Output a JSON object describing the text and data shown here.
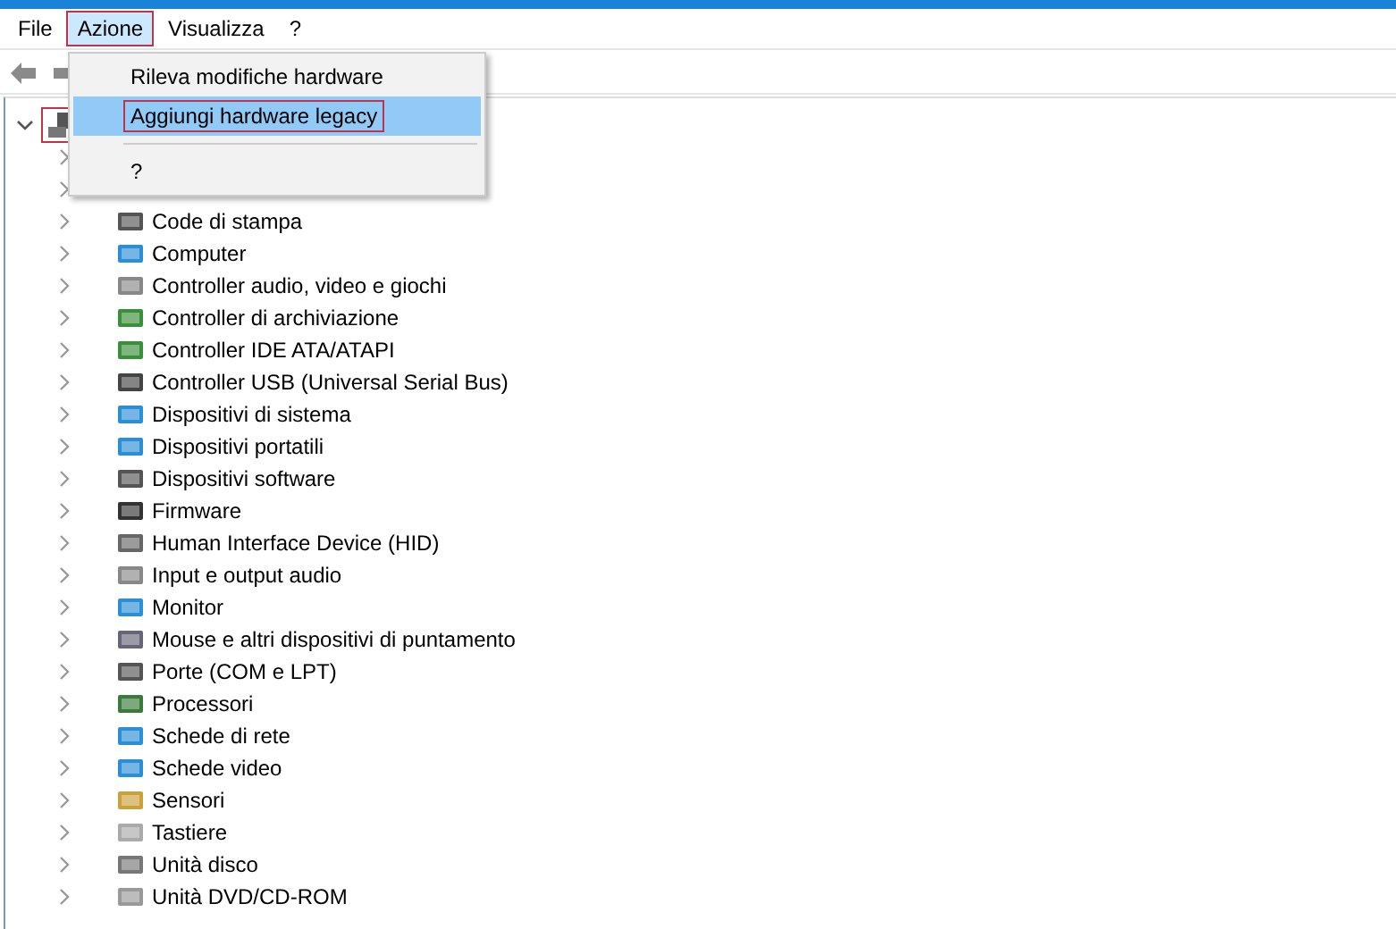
{
  "menu_bar": [
    {
      "label": "File",
      "selected": false
    },
    {
      "label": "Azione",
      "selected": true
    },
    {
      "label": "Visualizza",
      "selected": false
    },
    {
      "label": "?",
      "selected": false
    }
  ],
  "dropdown_menu": [
    {
      "label": "Rileva modifiche hardware",
      "selected": false,
      "kind": "item"
    },
    {
      "label": "Aggiungi hardware legacy",
      "selected": true,
      "kind": "item"
    },
    {
      "kind": "separator"
    },
    {
      "label": "?",
      "selected": false,
      "kind": "item"
    }
  ],
  "tree": {
    "expanded": true,
    "selected": true,
    "children": [
      {
        "expanded": false
      },
      {
        "expanded": false
      },
      {
        "label": "Code di stampa",
        "expanded": false
      },
      {
        "label": "Computer",
        "expanded": false
      },
      {
        "label": "Controller audio, video e giochi",
        "expanded": false
      },
      {
        "label": "Controller di archiviazione",
        "expanded": false
      },
      {
        "label": "Controller IDE ATA/ATAPI",
        "expanded": false
      },
      {
        "label": "Controller USB (Universal Serial Bus)",
        "expanded": false
      },
      {
        "label": "Dispositivi di sistema",
        "expanded": false
      },
      {
        "label": "Dispositivi portatili",
        "expanded": false
      },
      {
        "label": "Dispositivi software",
        "expanded": false
      },
      {
        "label": "Firmware",
        "expanded": false
      },
      {
        "label": "Human Interface Device (HID)",
        "expanded": false
      },
      {
        "label": "Input e output audio",
        "expanded": false
      },
      {
        "label": "Monitor",
        "expanded": false
      },
      {
        "label": "Mouse e altri dispositivi di puntamento",
        "expanded": false
      },
      {
        "label": "Porte (COM e LPT)",
        "expanded": false
      },
      {
        "label": "Processori",
        "expanded": false
      },
      {
        "label": "Schede di rete",
        "expanded": false
      },
      {
        "label": "Schede video",
        "expanded": false
      },
      {
        "label": "Sensori",
        "expanded": false
      },
      {
        "label": "Tastiere",
        "expanded": false
      },
      {
        "label": "Unità disco",
        "expanded": false
      },
      {
        "label": "Unità DVD/CD-ROM",
        "expanded": false
      }
    ]
  }
}
